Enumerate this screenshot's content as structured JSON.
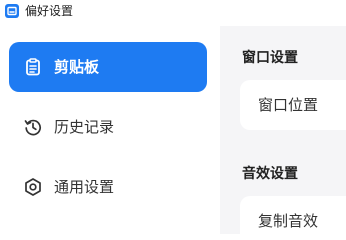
{
  "window": {
    "title": "偏好设置",
    "app_icon": "clipboard-app-icon"
  },
  "sidebar": {
    "items": [
      {
        "label": "剪贴板",
        "icon": "clipboard-icon",
        "active": true
      },
      {
        "label": "历史记录",
        "icon": "history-icon",
        "active": false
      },
      {
        "label": "通用设置",
        "icon": "settings-hexagon-icon",
        "active": false
      }
    ]
  },
  "content": {
    "sections": [
      {
        "title": "窗口设置",
        "rows": [
          {
            "label": "窗口位置"
          }
        ]
      },
      {
        "title": "音效设置",
        "rows": [
          {
            "label": "复制音效"
          }
        ]
      }
    ]
  },
  "colors": {
    "accent": "#1e7bf2",
    "panel_bg": "#f5f5f7",
    "card_bg": "#ffffff"
  }
}
